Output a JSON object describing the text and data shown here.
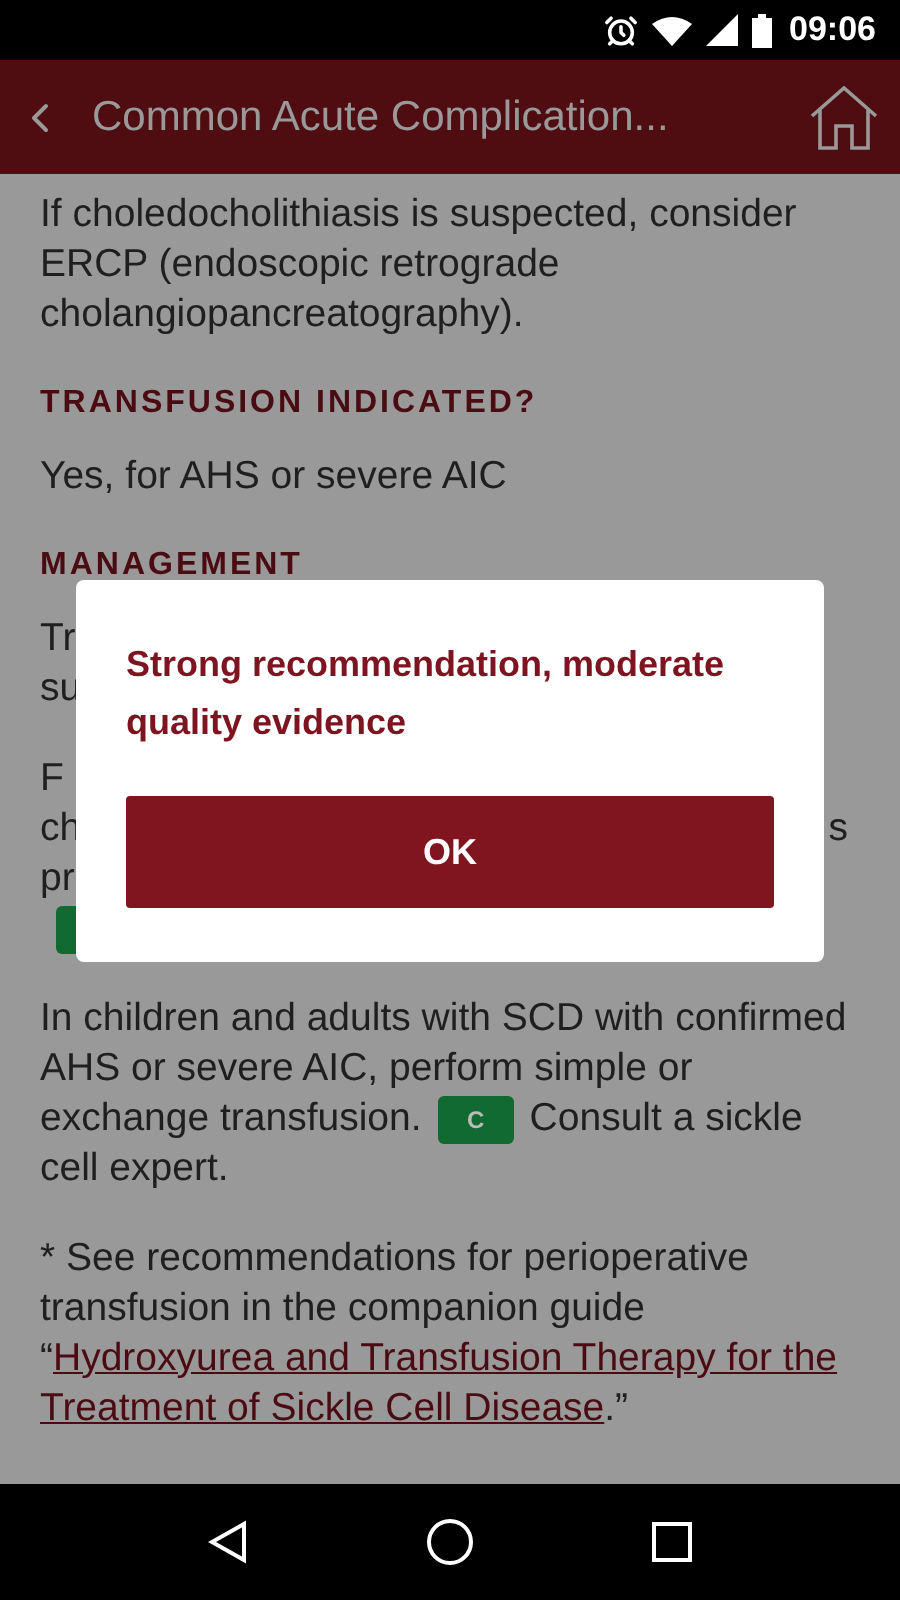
{
  "status_bar": {
    "time": "09:06"
  },
  "header": {
    "title": "Common Acute Complication..."
  },
  "content": [
    {
      "kind": "paragraph",
      "lines": [
        [
          {
            "kind": "text",
            "text": "If choledocholithiasis is suspected, consider"
          }
        ],
        [
          {
            "kind": "text",
            "text": "ERCP (endoscopic retrograde"
          }
        ],
        [
          {
            "kind": "text",
            "text": "cholangiopancreatography)."
          }
        ]
      ]
    },
    {
      "kind": "heading",
      "text": "TRANSFUSION INDICATED?"
    },
    {
      "kind": "paragraph",
      "lines": [
        [
          {
            "kind": "text",
            "text": "Yes, for AHS or severe AIC"
          }
        ]
      ]
    },
    {
      "kind": "heading",
      "text": "MANAGEMENT"
    },
    {
      "kind": "paragraph",
      "lines": [
        [
          {
            "kind": "text",
            "text": "Tr"
          }
        ],
        [
          {
            "kind": "text",
            "text": "su"
          }
        ]
      ]
    },
    {
      "kind": "paragraph",
      "lines": [
        [
          {
            "kind": "text",
            "text": "F"
          }
        ],
        [
          {
            "kind": "text",
            "text": "ch"
          },
          {
            "kind": "edge",
            "text": "s"
          }
        ],
        [
          {
            "kind": "text",
            "text": "pr"
          }
        ],
        [
          {
            "kind": "badge",
            "color": "#116a2f"
          }
        ]
      ]
    },
    {
      "kind": "paragraph",
      "lines": [
        [
          {
            "kind": "text",
            "text": "In children and adults with SCD with confirmed"
          }
        ],
        [
          {
            "kind": "text",
            "text": "AHS or severe AIC, perform simple or"
          }
        ],
        [
          {
            "kind": "text",
            "text": "exchange transfusion."
          },
          {
            "kind": "badge",
            "text": "C",
            "color": "#116a2f"
          },
          {
            "kind": "text",
            "text": "Consult a sickle"
          }
        ],
        [
          {
            "kind": "text",
            "text": "cell expert."
          }
        ]
      ]
    },
    {
      "kind": "paragraph",
      "lines": [
        [
          {
            "kind": "text",
            "text": "* See recommendations for perioperative"
          }
        ],
        [
          {
            "kind": "text",
            "text": "transfusion in the companion guide"
          }
        ],
        [
          {
            "kind": "text",
            "text": "“"
          },
          {
            "kind": "link",
            "text": "Hydroxyurea and Transfusion Therapy for the"
          }
        ],
        [
          {
            "kind": "link",
            "text": "Treatment of Sickle Cell Disease"
          },
          {
            "kind": "text",
            "text": ".”"
          }
        ]
      ]
    }
  ],
  "dialog": {
    "message": "Strong recommendation, moderate quality evidence",
    "button": "OK"
  }
}
